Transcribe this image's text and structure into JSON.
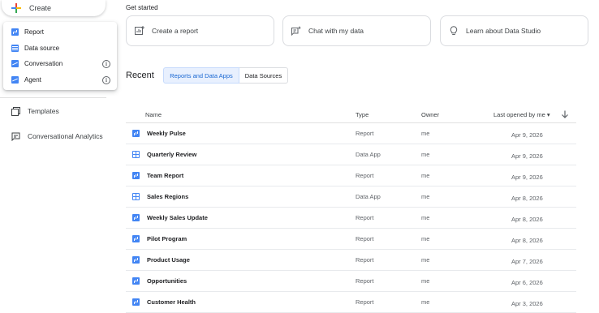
{
  "sidebar": {
    "create_label": "Create",
    "menu": [
      {
        "label": "Report",
        "icon": "report-icon",
        "info": false
      },
      {
        "label": "Data source",
        "icon": "data-source-icon",
        "info": false
      },
      {
        "label": "Conversation",
        "icon": "conversation-icon",
        "info": true
      },
      {
        "label": "Agent",
        "icon": "agent-icon",
        "info": true
      }
    ],
    "templates_label": "Templates",
    "conversational_label": "Conversational Analytics",
    "info_glyph": "i"
  },
  "get_started": {
    "title": "Get started",
    "cards": [
      {
        "label": "Create a report",
        "icon": "add-chart-icon"
      },
      {
        "label": "Chat with my data",
        "icon": "chat-sparkle-icon"
      },
      {
        "label": "Learn about Data Studio",
        "icon": "lightbulb-icon"
      }
    ]
  },
  "recent": {
    "title": "Recent",
    "tabs": [
      "Reports and Data Apps",
      "Data Sources"
    ],
    "active_tab": 0
  },
  "table": {
    "headers": {
      "name": "Name",
      "type": "Type",
      "owner": "Owner",
      "last_opened": "Last opened by me ▾"
    },
    "rows": [
      {
        "name": "Weekly Pulse",
        "type": "Report",
        "owner": "me",
        "date": "Apr 9, 2026",
        "icon": "report"
      },
      {
        "name": "Quarterly  Review",
        "type": "Data App",
        "owner": "me",
        "date": "Apr 9, 2026",
        "icon": "app"
      },
      {
        "name": "Team Report",
        "type": "Report",
        "owner": "me",
        "date": "Apr 9, 2026",
        "icon": "report"
      },
      {
        "name": "Sales Regions",
        "type": "Data App",
        "owner": "me",
        "date": "Apr 8, 2026",
        "icon": "app"
      },
      {
        "name": "Weekly Sales Update",
        "type": "Report",
        "owner": "me",
        "date": "Apr 8, 2026",
        "icon": "report"
      },
      {
        "name": "Pilot Program",
        "type": "Report",
        "owner": "me",
        "date": "Apr 8, 2026",
        "icon": "report"
      },
      {
        "name": "Product Usage",
        "type": "Report",
        "owner": "me",
        "date": "Apr 7, 2026",
        "icon": "report"
      },
      {
        "name": "Opportunities",
        "type": "Report",
        "owner": "me",
        "date": "Apr 6, 2026",
        "icon": "report"
      },
      {
        "name": "Customer Health",
        "type": "Report",
        "owner": "me",
        "date": "Apr 3, 2026",
        "icon": "report"
      }
    ]
  },
  "colors": {
    "accent": "#4285f4",
    "active_tab_bg": "#e8f0fe",
    "active_tab_text": "#1967d2"
  }
}
